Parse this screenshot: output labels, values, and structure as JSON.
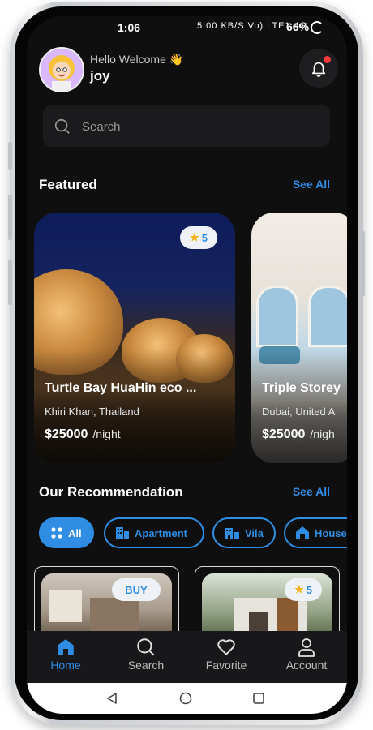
{
  "status_bar": {
    "time": "1:06",
    "system_icons": "5.00 KB/S Vo) LTE1 4G",
    "battery": "66%"
  },
  "header": {
    "greeting": "Hello Welcome",
    "wave_emoji": "👋",
    "username": "joy",
    "notification_icon": "bell-icon"
  },
  "search": {
    "placeholder": "Search"
  },
  "featured": {
    "title": "Featured",
    "see_all": "See All",
    "cards": [
      {
        "rating": "5",
        "name": "Turtle Bay HuaHin eco ...",
        "location": "Khiri Khan, Thailand",
        "price": "$25000",
        "per": "/night"
      },
      {
        "name": "Triple Storey",
        "location": "Dubai, United A",
        "price": "$25000",
        "per": "/nigh"
      }
    ]
  },
  "recommendation": {
    "title": "Our Recommendation",
    "see_all": "See All",
    "chips": [
      {
        "label": "All",
        "icon": "grid-icon",
        "active": true
      },
      {
        "label": "Apartment",
        "icon": "building-icon"
      },
      {
        "label": "Vila",
        "icon": "vila-icon"
      },
      {
        "label": "House",
        "icon": "house-icon"
      }
    ],
    "cards": [
      {
        "badge": "BUY"
      },
      {
        "rating": "5"
      }
    ]
  },
  "bottom_nav": [
    {
      "label": "Home",
      "icon": "home-icon",
      "active": true
    },
    {
      "label": "Search",
      "icon": "search-icon"
    },
    {
      "label": "Favorite",
      "icon": "heart-icon"
    },
    {
      "label": "Account",
      "icon": "account-icon"
    }
  ],
  "colors": {
    "accent": "#2f8de4",
    "background": "#0f0f10",
    "surface": "#1b1b1d"
  }
}
